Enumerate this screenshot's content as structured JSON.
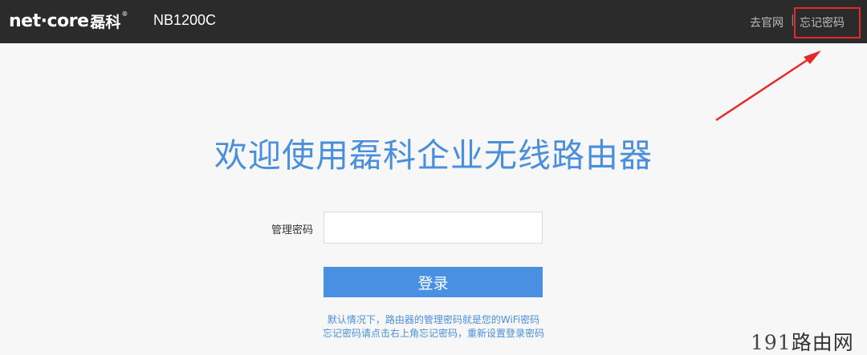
{
  "header": {
    "logo_en": "net·core",
    "logo_zh": "磊科",
    "logo_reg": "®",
    "model": "NB1200C",
    "nav": {
      "official_site": "去官网",
      "separator": "|",
      "forgot_password": "忘记密码"
    }
  },
  "main": {
    "welcome_title": "欢迎使用磊科企业无线路由器",
    "password_label": "管理密码",
    "password_value": "",
    "login_button": "登录",
    "hint_line1": "默认情况下，路由器的管理密码就是您的WiFi密码",
    "hint_line2": "忘记密码请点击右上角忘记密码，重新设置登录密码"
  },
  "watermark": {
    "number": "191",
    "text": "路由网"
  },
  "colors": {
    "topbar": "#2b2b2b",
    "accent_blue": "#4a90e2",
    "annotation_red": "#e62a2a"
  },
  "icons": [
    "annotation-arrow-icon"
  ]
}
